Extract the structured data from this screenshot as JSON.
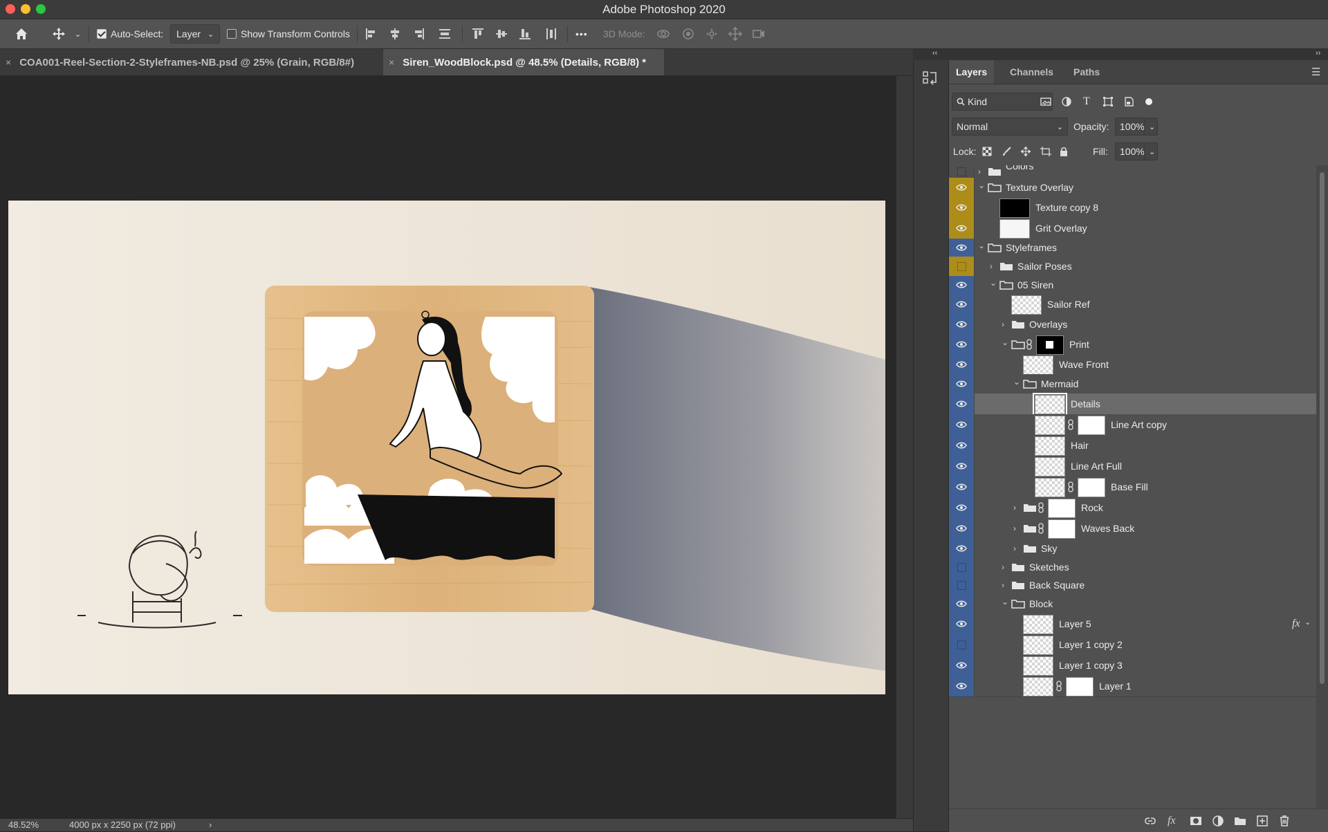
{
  "app": {
    "title": "Adobe Photoshop 2020"
  },
  "options_bar": {
    "auto_select_label": "Auto-Select:",
    "auto_select_checked": true,
    "auto_select_value": "Layer",
    "show_transform_label": "Show Transform Controls",
    "show_transform_checked": false,
    "more_label": "•••",
    "mode_3d_label": "3D Mode:"
  },
  "tabs": [
    {
      "label": "COA001-Reel-Section-2-Styleframes-NB.psd @ 25% (Grain, RGB/8#)",
      "close": "×",
      "active": false
    },
    {
      "label": "Siren_WoodBlock.psd @ 48.5% (Details, RGB/8) *",
      "close": "×",
      "active": true
    }
  ],
  "status": {
    "zoom": "48.52%",
    "doc_info": "4000 px x 2250 px (72 ppi)",
    "arrow": "›"
  },
  "layers_panel": {
    "tabs": [
      "Layers",
      "Channels",
      "Paths"
    ],
    "filter_kind": "Kind",
    "blend_mode": "Normal",
    "opacity_label": "Opacity:",
    "opacity_value": "100%",
    "lock_label": "Lock:",
    "fill_label": "Fill:",
    "fill_value": "100%",
    "collapse_left": "‹‹",
    "collapse_right": "››",
    "fx_label": "fx"
  },
  "layers": [
    {
      "name": "Colors",
      "type": "group",
      "indent": 0,
      "expanded": false,
      "visible": false,
      "color": "none",
      "partial": true
    },
    {
      "name": "Texture Overlay",
      "type": "group",
      "indent": 0,
      "expanded": true,
      "visible": true,
      "color": "yellow"
    },
    {
      "name": "Texture copy 8",
      "type": "layer",
      "indent": 1,
      "visible": true,
      "color": "yellow",
      "thumb": "black"
    },
    {
      "name": "Grit Overlay",
      "type": "layer",
      "indent": 1,
      "visible": true,
      "color": "yellow",
      "thumb": "white"
    },
    {
      "name": "Styleframes",
      "type": "group",
      "indent": 0,
      "expanded": true,
      "visible": true,
      "color": "blue"
    },
    {
      "name": "Sailor Poses",
      "type": "group",
      "indent": 1,
      "expanded": false,
      "visible": false,
      "color": "yellow"
    },
    {
      "name": "05 Siren",
      "type": "group",
      "indent": 1,
      "expanded": true,
      "visible": true,
      "color": "blue"
    },
    {
      "name": "Sailor Ref",
      "type": "layer",
      "indent": 2,
      "visible": true,
      "color": "blue",
      "thumb": "checker"
    },
    {
      "name": "Overlays",
      "type": "group",
      "indent": 2,
      "expanded": false,
      "visible": true,
      "color": "blue"
    },
    {
      "name": "Print",
      "type": "group",
      "indent": 2,
      "expanded": true,
      "visible": true,
      "color": "blue",
      "mask": "print"
    },
    {
      "name": "Wave Front",
      "type": "layer",
      "indent": 3,
      "visible": true,
      "color": "blue",
      "thumb": "checker"
    },
    {
      "name": "Mermaid",
      "type": "group",
      "indent": 3,
      "expanded": true,
      "visible": true,
      "color": "blue"
    },
    {
      "name": "Details",
      "type": "layer",
      "indent": 4,
      "visible": true,
      "color": "blue",
      "thumb": "checker",
      "selected": true
    },
    {
      "name": "Line Art copy",
      "type": "layer",
      "indent": 4,
      "visible": true,
      "color": "blue",
      "thumb": "checker",
      "mask": "white"
    },
    {
      "name": "Hair",
      "type": "layer",
      "indent": 4,
      "visible": true,
      "color": "blue",
      "thumb": "checker"
    },
    {
      "name": "Line Art Full",
      "type": "layer",
      "indent": 4,
      "visible": true,
      "color": "blue",
      "thumb": "checker"
    },
    {
      "name": "Base Fill",
      "type": "layer",
      "indent": 4,
      "visible": true,
      "color": "blue",
      "thumb": "checker",
      "mask": "white"
    },
    {
      "name": "Rock",
      "type": "group",
      "indent": 3,
      "expanded": false,
      "visible": true,
      "color": "blue",
      "mask": "white"
    },
    {
      "name": "Waves Back",
      "type": "group",
      "indent": 3,
      "expanded": false,
      "visible": true,
      "color": "blue",
      "mask": "white"
    },
    {
      "name": "Sky",
      "type": "group",
      "indent": 3,
      "expanded": false,
      "visible": true,
      "color": "blue"
    },
    {
      "name": "Sketches",
      "type": "group",
      "indent": 2,
      "expanded": false,
      "visible": false,
      "color": "blue"
    },
    {
      "name": "Back Square",
      "type": "group",
      "indent": 2,
      "expanded": false,
      "visible": false,
      "color": "blue"
    },
    {
      "name": "Block",
      "type": "group",
      "indent": 2,
      "expanded": true,
      "visible": true,
      "color": "blue"
    },
    {
      "name": "Layer 5",
      "type": "layer",
      "indent": 3,
      "visible": true,
      "color": "blue",
      "thumb": "checker",
      "fx": true
    },
    {
      "name": "Layer 1 copy 2",
      "type": "layer",
      "indent": 3,
      "visible": false,
      "color": "blue",
      "thumb": "checker"
    },
    {
      "name": "Layer 1 copy 3",
      "type": "layer",
      "indent": 3,
      "visible": true,
      "color": "blue",
      "thumb": "checker"
    },
    {
      "name": "Layer 1",
      "type": "layer",
      "indent": 3,
      "visible": true,
      "color": "blue",
      "thumb": "checker",
      "mask": "white"
    }
  ],
  "colors": {
    "accent_yellow": "#ad8d1a",
    "accent_blue": "#3f6096",
    "panel_bg": "#505050",
    "selected_row": "#6b6b6b"
  }
}
